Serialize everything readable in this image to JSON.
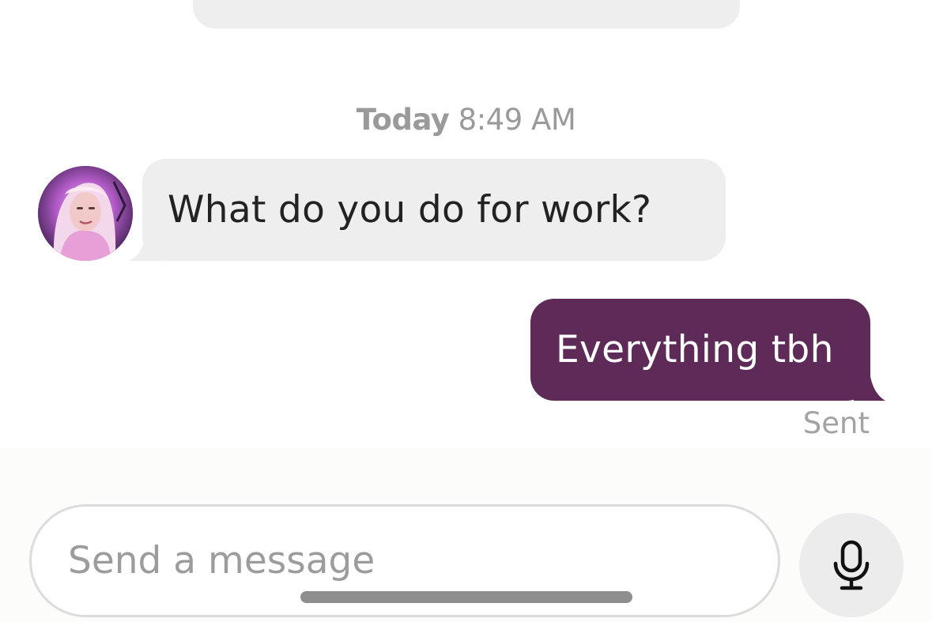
{
  "chat": {
    "timestamp_day": "Today",
    "timestamp_time": "8:49 AM",
    "incoming_message": "What do you do for work?",
    "outgoing_message": "Everything tbh",
    "status": "Sent"
  },
  "composer": {
    "placeholder": "Send a message",
    "mic_icon": "microphone-icon"
  },
  "colors": {
    "incoming_bubble": "#eeeeee",
    "outgoing_bubble": "#5e2b58",
    "muted_text": "#9a9a9a"
  }
}
